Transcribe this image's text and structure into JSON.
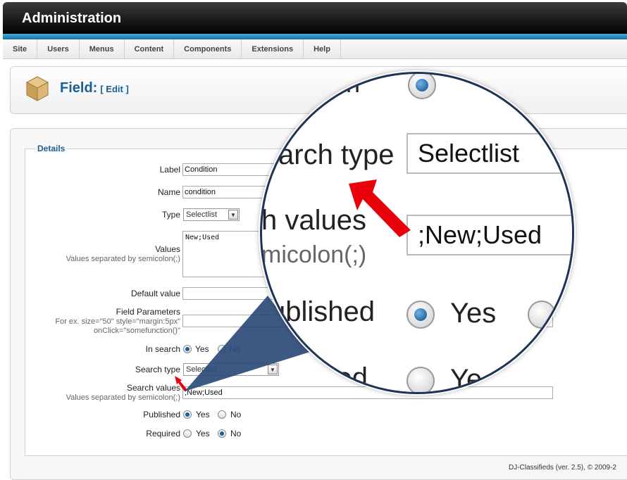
{
  "app": {
    "title": "Administration"
  },
  "menu": [
    "Site",
    "Users",
    "Menus",
    "Content",
    "Components",
    "Extensions",
    "Help"
  ],
  "page": {
    "title": "Field:",
    "edit_label": "[ Edit ]"
  },
  "form": {
    "legend": "Details",
    "label": {
      "label": "Label",
      "value": "Condition"
    },
    "name": {
      "label": "Name",
      "value": "condition"
    },
    "type": {
      "label": "Type",
      "value": "Selectlist"
    },
    "values": {
      "label": "Values",
      "hint": "Values separated by semicolon(;)",
      "value": "New;Used"
    },
    "default_value": {
      "label": "Default value",
      "value": ""
    },
    "field_parameters": {
      "label": "Field Parameters",
      "hint1": "For ex. size=\"50\" style=\"margin:5px\"",
      "hint2": "onClick=\"somefunction()\"",
      "value": ""
    },
    "in_search": {
      "label": "In search",
      "yes": "Yes",
      "no": "No",
      "selected": "Yes"
    },
    "search_type": {
      "label": "Search type",
      "value": "Selectlist"
    },
    "search_values": {
      "label": "Search values",
      "hint": "Values separated by semicolon(;)",
      "value": ";New;Used"
    },
    "published": {
      "label": "Published",
      "yes": "Yes",
      "no": "No",
      "selected": "Yes"
    },
    "required": {
      "label": "Required",
      "yes": "Yes",
      "no": "No",
      "selected": "No"
    }
  },
  "zoom": {
    "search_type_label": "arch type",
    "search_type_value": "Selectlist",
    "search_values_label": "h values",
    "search_values_value": ";New;Used",
    "hint_fragment": "micolon(;)",
    "published_label": "ublished",
    "published_yes": "Yes",
    "required_label": "uired",
    "required_yes": "Ye",
    "top_fragment": "ch"
  },
  "footer": {
    "text": "DJ-Classifieds (ver. 2.5), © 2009-2"
  },
  "colors": {
    "accent": "#1a5f97",
    "arrow": "#e8000a",
    "lens_border": "#1e3456"
  },
  "icons": {
    "page": "box-icon",
    "pointer": "red-arrow-icon"
  }
}
